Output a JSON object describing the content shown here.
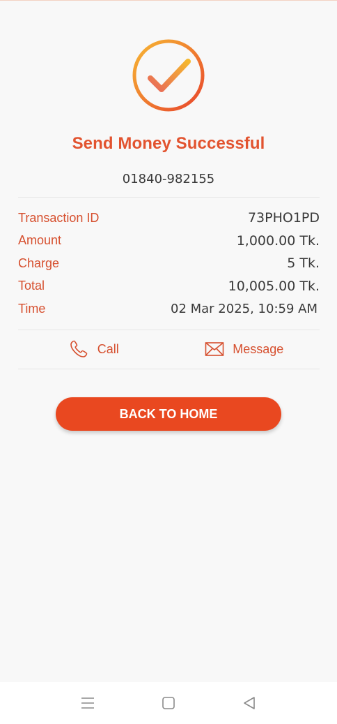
{
  "status": {
    "title": "Send Money Successful",
    "recipient_number": "01840-982155"
  },
  "details": [
    {
      "label": "Transaction ID",
      "value": "73PHO1PD"
    },
    {
      "label": "Amount",
      "value": "1,000.00 Tk."
    },
    {
      "label": "Charge",
      "value": "5 Tk."
    },
    {
      "label": "Total",
      "value": "10,005.00 Tk."
    },
    {
      "label": "Time",
      "value": "02 Mar 2025, 10:59 AM"
    }
  ],
  "actions": {
    "call_label": "Call",
    "message_label": "Message"
  },
  "back_button_label": "BACK TO HOME",
  "icons": {
    "status": "checkmark-circle-icon",
    "call": "phone-icon",
    "message": "envelope-icon",
    "nav_menu": "menu-icon",
    "nav_home": "home-square-icon",
    "nav_back": "back-triangle-icon"
  },
  "colors": {
    "accent": "#e94820",
    "label": "#d64f2e",
    "icon_gradient_start": "#f7b733",
    "icon_gradient_end": "#e8452c"
  }
}
